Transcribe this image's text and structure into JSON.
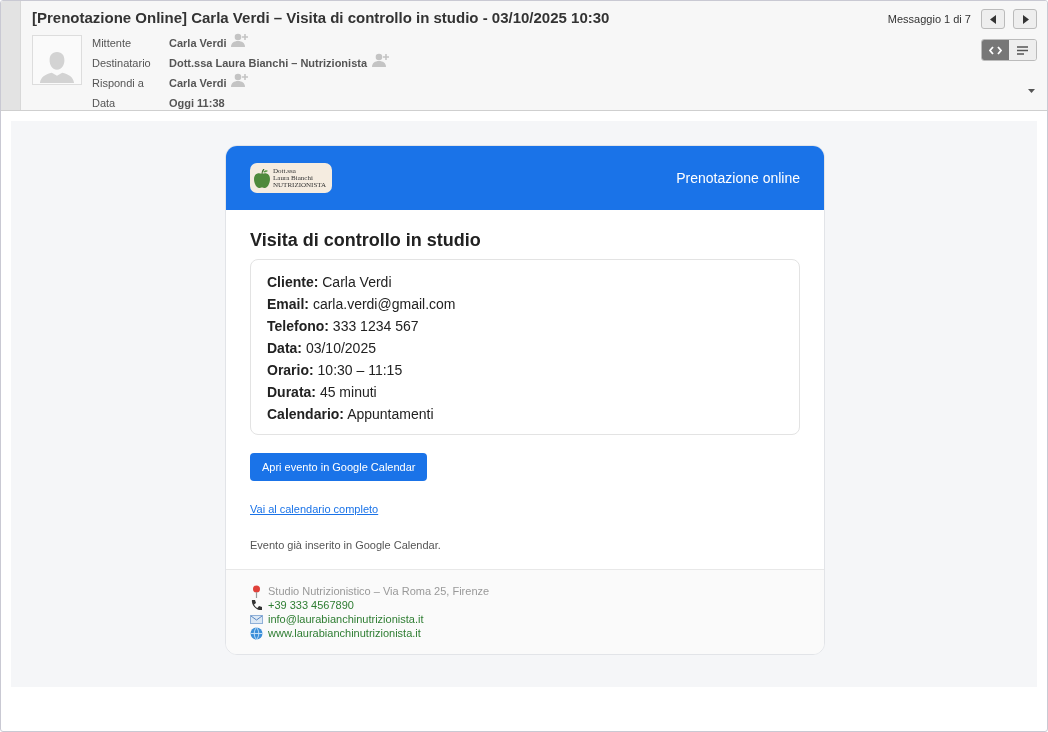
{
  "header": {
    "subject": "[Prenotazione Online] Carla Verdi – Visita di controllo in studio - 03/10/2025 10:30",
    "fields": [
      {
        "label": "Mittente",
        "value": "Carla Verdi",
        "add_contact": true
      },
      {
        "label": "Destinatario",
        "value": "Dott.ssa Laura Bianchi – Nutrizionista",
        "add_contact": true
      },
      {
        "label": "Rispondi a",
        "value": "Carla Verdi",
        "add_contact": true
      },
      {
        "label": "Data",
        "value": "Oggi 11:38",
        "add_contact": false
      }
    ],
    "counter": "Messaggio 1 di 7",
    "view_modes": [
      {
        "kind": "html",
        "selected": true
      },
      {
        "kind": "text",
        "selected": false
      }
    ]
  },
  "email": {
    "logo": {
      "lines": [
        "Dott.ssa",
        "Laura Bianchi",
        "NUTRIZIONISTA"
      ]
    },
    "banner_title": "Prenotazione online",
    "title": "Visita di controllo in studio",
    "details": [
      {
        "label": "Cliente:",
        "value": "Carla Verdi"
      },
      {
        "label": "Email:",
        "value": "carla.verdi@gmail.com"
      },
      {
        "label": "Telefono:",
        "value": "333 1234 567"
      },
      {
        "label": "Data:",
        "value": "03/10/2025"
      },
      {
        "label": "Orario:",
        "value": "10:30 – 11:15"
      },
      {
        "label": "Durata:",
        "value": "45 minuti"
      },
      {
        "label": "Calendario:",
        "value": "Appuntamenti"
      }
    ],
    "button": "Apri evento in Google Calendar",
    "link": "Vai al calendario completo",
    "note": "Evento già inserito in Google Calendar.",
    "footer": [
      {
        "kind": "address",
        "text": "Studio Nutrizionistico – Via Roma 25, Firenze"
      },
      {
        "kind": "phone",
        "text": "+39 333 4567890"
      },
      {
        "kind": "email",
        "text": "info@laurabianchinutrizionista.it"
      },
      {
        "kind": "web",
        "text": "www.laurabianchinutrizionista.it"
      }
    ]
  }
}
